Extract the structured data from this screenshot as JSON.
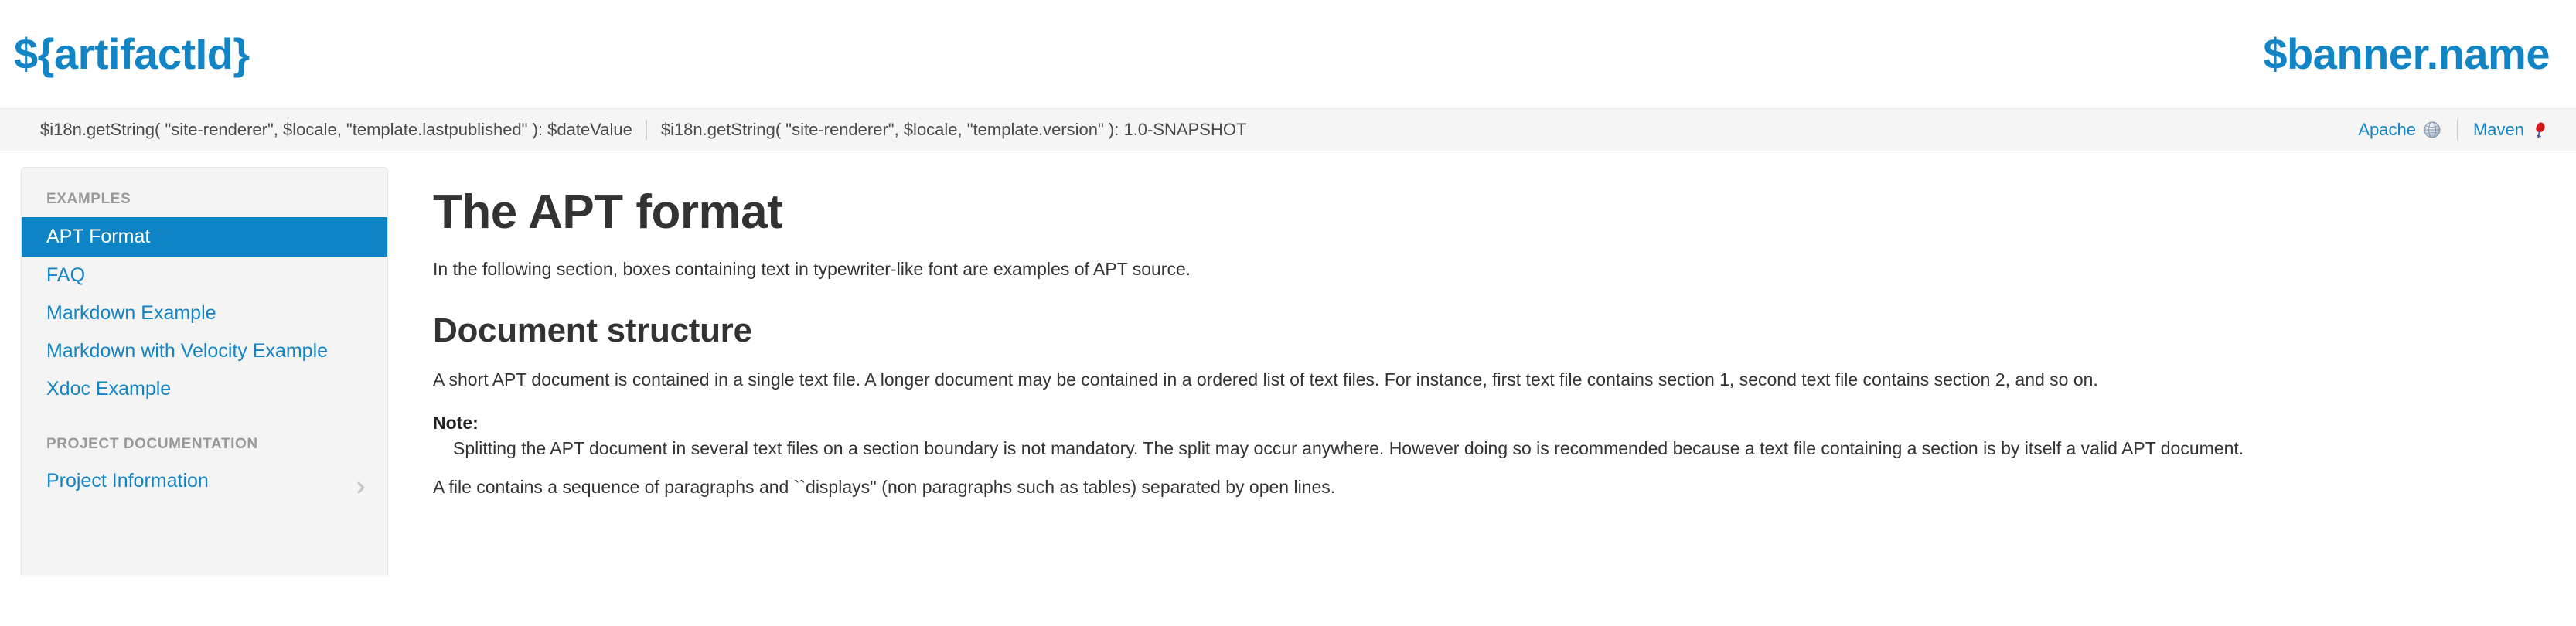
{
  "banner": {
    "left_title": "${artifactId}",
    "right_title": "$banner.name"
  },
  "breadcrumb": {
    "last_published": "$i18n.getString( \"site-renderer\", $locale, \"template.lastpublished\" ): $dateValue",
    "version": "$i18n.getString( \"site-renderer\", $locale, \"template.version\" ): 1.0-SNAPSHOT"
  },
  "banner_links": [
    {
      "label": "Apache",
      "icon": "globe-icon"
    },
    {
      "label": "Maven",
      "icon": "feather-icon"
    }
  ],
  "sidebar": {
    "sections": [
      {
        "heading": "Examples",
        "items": [
          {
            "label": "APT Format",
            "active": true
          },
          {
            "label": "FAQ",
            "active": false
          },
          {
            "label": "Markdown Example",
            "active": false
          },
          {
            "label": "Markdown with Velocity Example",
            "active": false
          },
          {
            "label": "Xdoc Example",
            "active": false
          }
        ]
      },
      {
        "heading": "Project Documentation",
        "items": [
          {
            "label": "Project Information",
            "active": false,
            "has_children": true
          }
        ]
      }
    ]
  },
  "main": {
    "page_title": "The APT format",
    "intro": "In the following section, boxes containing text in typewriter-like font are examples of APT source.",
    "section_title": "Document structure",
    "paragraph_1": "A short APT document is contained in a single text file. A longer document may be contained in a ordered list of text files. For instance, first text file contains section 1, second text file contains section 2, and so on.",
    "note_label": "Note:",
    "note_body": "Splitting the APT document in several text files on a section boundary is not mandatory. The split may occur anywhere. However doing so is recommended because a text file containing a section is by itself a valid APT document.",
    "paragraph_2": "A file contains a sequence of paragraphs and ``displays'' (non paragraphs such as tables) separated by open lines."
  },
  "colors": {
    "accent_blue": "#1184c6",
    "active_blue": "#0e84c4",
    "bar_background": "#f5f5f5",
    "sidebar_background": "#f4f4f4",
    "text": "#333333",
    "muted": "#999999"
  }
}
